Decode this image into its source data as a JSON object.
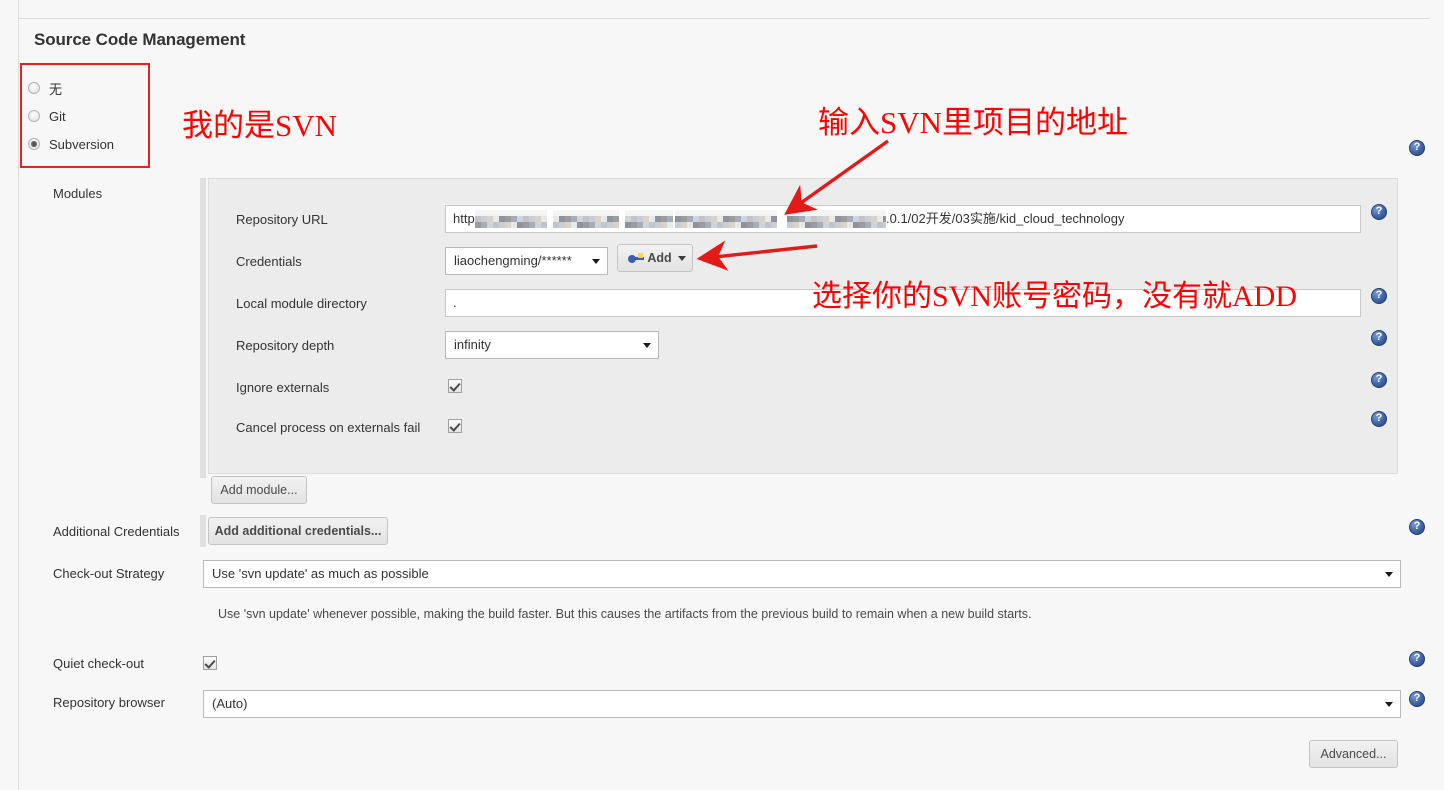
{
  "section": {
    "title": "Source Code Management"
  },
  "scm_options": [
    {
      "label": "无",
      "checked": false,
      "name": "radio-scm-none"
    },
    {
      "label": "Git",
      "checked": false,
      "name": "radio-scm-git"
    },
    {
      "label": "Subversion",
      "checked": true,
      "name": "radio-scm-subversion"
    }
  ],
  "modules": {
    "label": "Modules",
    "fields": {
      "repository_url": {
        "label": "Repository URL",
        "value": "http",
        "value_tail": ".0.1/02开发/03实施/kid_cloud_technology"
      },
      "credentials": {
        "label": "Credentials",
        "value": "liaochengming/******"
      },
      "add_credentials_button": "Add",
      "local_module_directory": {
        "label": "Local module directory",
        "value": "."
      },
      "repository_depth": {
        "label": "Repository depth",
        "value": "infinity"
      },
      "ignore_externals": {
        "label": "Ignore externals",
        "checked": true
      },
      "cancel_process_on_externals_fail": {
        "label": "Cancel process on externals fail",
        "checked": true
      }
    },
    "add_module_button": "Add module..."
  },
  "additional_credentials": {
    "label": "Additional Credentials",
    "button": "Add additional credentials..."
  },
  "checkout_strategy": {
    "label": "Check-out Strategy",
    "value": "Use 'svn update' as much as possible",
    "help": "Use 'svn update' whenever possible, making the build faster. But this causes the artifacts from the previous build to remain when a new build starts."
  },
  "quiet_checkout": {
    "label": "Quiet check-out",
    "checked": true
  },
  "repository_browser": {
    "label": "Repository browser",
    "value": "(Auto)"
  },
  "advanced_button": "Advanced...",
  "annotations": {
    "scm_choice": "我的是SVN",
    "repository_url": "输入SVN里项目的地址",
    "credentials": "选择你的SVN账号密码，没有就ADD"
  },
  "colors": {
    "annotation_red": "#ff0000",
    "highlight_box": "#e8201e",
    "help_icon_blue": "#3e63a6",
    "page_background": "#f7f7f7",
    "panel_background": "#ececec"
  },
  "icons": {
    "help": "help-question-icon",
    "key": "key-icon",
    "caret": "chevron-down-icon"
  }
}
